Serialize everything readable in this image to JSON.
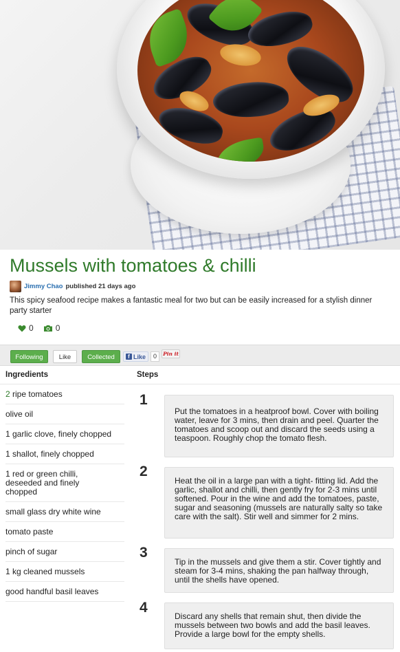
{
  "recipe": {
    "title": "Mussels with tomatoes & chilli",
    "author": "Jimmy Chao",
    "published": "published 21 days ago",
    "description": "This spicy seafood recipe makes a fantastic meal for two but can be easily increased for a stylish dinner party starter",
    "likes_count": "0",
    "photos_count": "0"
  },
  "actions": {
    "following_label": "Following",
    "like_label": "Like",
    "collected_label": "Collected",
    "fb_like_label": "Like",
    "fb_like_count": "0",
    "pinit_label": "Pin it"
  },
  "sections": {
    "ingredients_heading": "Ingredients",
    "steps_heading": "Steps"
  },
  "ingredients": [
    {
      "qty": "2",
      "text": " ripe tomatoes"
    },
    {
      "qty": "",
      "text": "olive oil"
    },
    {
      "qty": "",
      "text": "1 garlic clove, finely chopped"
    },
    {
      "qty": "",
      "text": "1 shallot, finely chopped"
    },
    {
      "qty": "",
      "text": "1 red or green chilli, deseeded and finely chopped"
    },
    {
      "qty": "",
      "text": "small glass dry white wine"
    },
    {
      "qty": "",
      "text": "tomato paste"
    },
    {
      "qty": "",
      "text": "pinch of sugar"
    },
    {
      "qty": "",
      "text": "1 kg cleaned mussels"
    },
    {
      "qty": "",
      "text": "good handful basil leaves"
    }
  ],
  "steps": [
    {
      "number": "1",
      "text": "Put the tomatoes in a heatproof bowl. Cover with boiling water, leave for 3 mins, then drain and peel. Quarter the tomatoes and scoop out and discard the seeds using a teaspoon. Roughly chop the tomato flesh."
    },
    {
      "number": "2",
      "text": "Heat the oil in a large pan with a tight- fitting lid. Add the garlic, shallot and chilli, then gently fry for 2-3 mins until softened. Pour in the wine and add the tomatoes, paste, sugar and seasoning (mussels are naturally salty so take care with the salt). Stir well and simmer for 2 mins."
    },
    {
      "number": "3",
      "text": "Tip in the mussels and give them a stir. Cover tightly and steam for 3-4 mins, shaking the pan halfway through, until the shells have opened."
    },
    {
      "number": "4",
      "text": "Discard any shells that remain shut, then divide the mussels between two bowls and add the basil leaves. Provide a large bowl for the empty shells."
    }
  ],
  "icons": {
    "heart": "heart-icon",
    "camera": "camera-icon",
    "facebook": "facebook-icon"
  },
  "colors": {
    "title_green": "#2f7a2a",
    "button_green": "#5cae4c",
    "author_blue": "#2a6fb0",
    "facebook_blue": "#3b5998",
    "pinterest_red": "#cb2027"
  }
}
